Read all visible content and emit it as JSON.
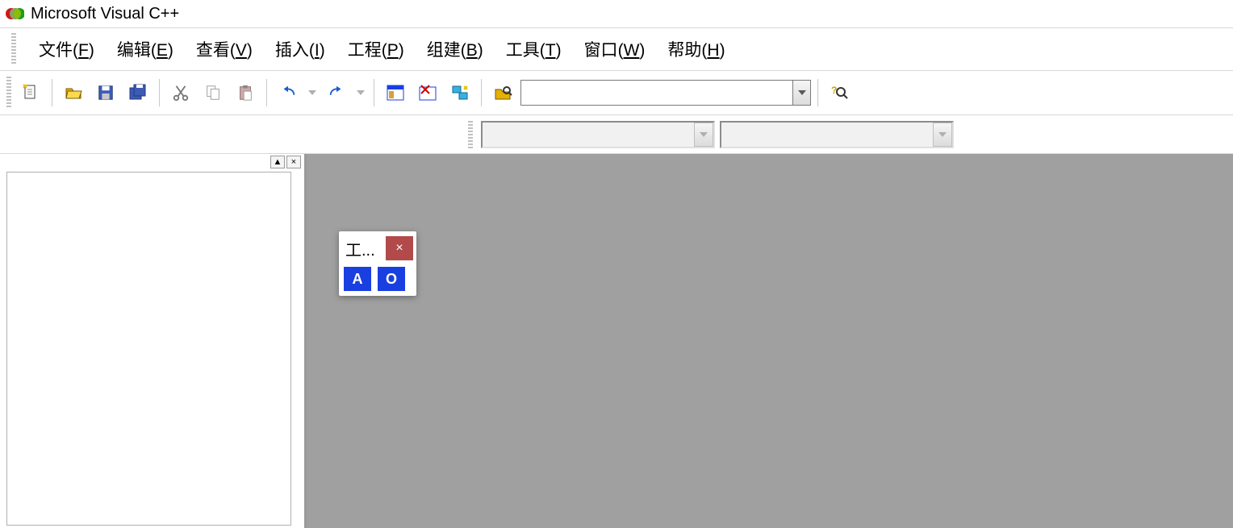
{
  "app": {
    "title": "Microsoft Visual C++"
  },
  "menu": {
    "file": {
      "label": "文件",
      "accel": "F"
    },
    "edit": {
      "label": "编辑",
      "accel": "E"
    },
    "view": {
      "label": "查看",
      "accel": "V"
    },
    "insert": {
      "label": "插入",
      "accel": "I"
    },
    "project": {
      "label": "工程",
      "accel": "P"
    },
    "build": {
      "label": "组建",
      "accel": "B"
    },
    "tools": {
      "label": "工具",
      "accel": "T"
    },
    "window": {
      "label": "窗口",
      "accel": "W"
    },
    "help": {
      "label": "帮助",
      "accel": "H"
    }
  },
  "toolbar": {
    "find_value": "",
    "combo_a_value": "",
    "combo_b_value": ""
  },
  "float": {
    "title": "工...",
    "close": "×",
    "btn_a": "A",
    "btn_o": "O"
  },
  "sidepane": {
    "collapse": "▲",
    "close": "×"
  }
}
